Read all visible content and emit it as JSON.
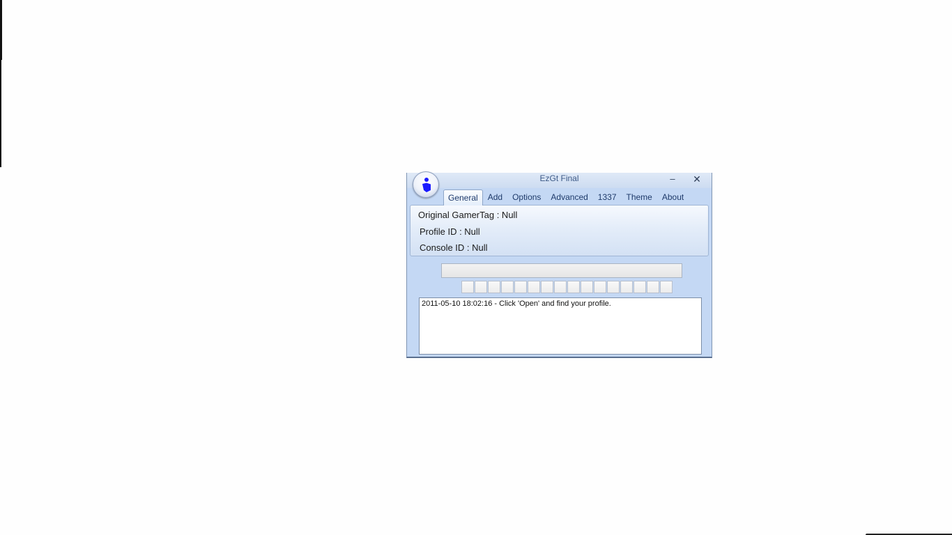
{
  "window": {
    "title": "EzGt Final",
    "minimize_glyph": "–",
    "close_glyph": "✕"
  },
  "orb": {
    "icon": "user-info-icon",
    "color": "#1a1aff"
  },
  "tabs": [
    {
      "label": "General",
      "active": true
    },
    {
      "label": "Add"
    },
    {
      "label": "Options"
    },
    {
      "label": "Advanced"
    },
    {
      "label": "1337"
    },
    {
      "label": "Theme"
    },
    {
      "label": "About"
    }
  ],
  "profile": {
    "original_gamertag": "Original GamerTag : Null",
    "profile_id": "Profile ID : Null",
    "console_id": "Console ID : Null"
  },
  "gamertag_input": {
    "value": ""
  },
  "char_boxes": {
    "values": [
      "",
      "",
      "",
      "",
      "",
      "",
      "",
      "",
      "",
      "",
      "",
      "",
      "",
      "",
      "",
      ""
    ]
  },
  "log": {
    "text": "2011-05-10 18:02:16 - Click 'Open' and find your profile."
  }
}
